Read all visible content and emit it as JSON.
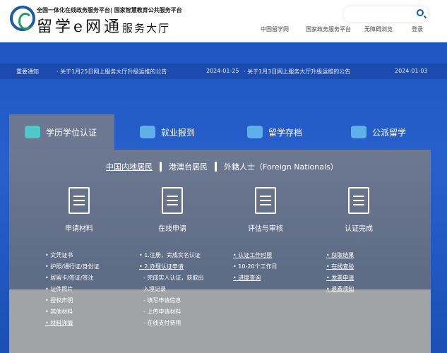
{
  "header": {
    "slogan": "全国一体化在线政务服务平台| 国家智慧教育公共服务平台",
    "brand": "留学e网通",
    "brand_sub": "服务大厅",
    "search_placeholder": "",
    "nav": [
      "中国留学网",
      "国家政务服务平台",
      "无障碍浏览",
      "登录"
    ]
  },
  "notice": {
    "label": "重要通知",
    "items": [
      {
        "title": "· 关于1月25日网上服务大厅升级运维的公告",
        "date": "2024-01-25"
      },
      {
        "title": "· 关于1月3日网上服务大厅升级运维的公告",
        "date": "2024-01-03"
      }
    ]
  },
  "tabs": [
    "学历学位认证",
    "就业报到",
    "留学存档",
    "公派留学"
  ],
  "sub_tabs": [
    "中国内地居民",
    "港澳台居民",
    "外籍人士（Foreign Nationals）"
  ],
  "steps": [
    {
      "title": "申请材料",
      "items": [
        "文凭证书",
        "护照/通行证/身份证",
        "居留卡/签证/签注",
        "证件照片",
        "授权声明",
        "其他材料",
        "材料详情"
      ]
    },
    {
      "title": "在线申请",
      "items": [
        "1.注册，完成实名认证",
        "2.办理认证申请",
        "- 完成实人认证，获取出",
        "入境记录",
        "- 填写申请信息",
        "- 上传申请材料",
        "- 在线支付费用"
      ]
    },
    {
      "title": "评估与审核",
      "items": [
        "认证工作时限",
        "10-20个工作日",
        "进度查询"
      ]
    },
    {
      "title": "认证完成",
      "items": [
        "获取结果",
        "在线查验",
        "发票申请",
        "退费须知"
      ]
    }
  ]
}
